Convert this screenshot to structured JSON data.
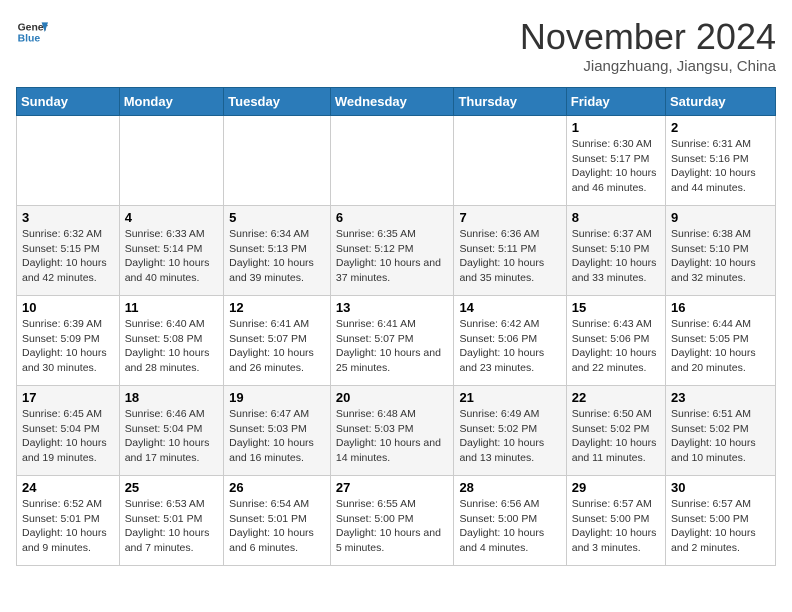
{
  "header": {
    "logo_line1": "General",
    "logo_line2": "Blue",
    "month": "November 2024",
    "location": "Jiangzhuang, Jiangsu, China"
  },
  "weekdays": [
    "Sunday",
    "Monday",
    "Tuesday",
    "Wednesday",
    "Thursday",
    "Friday",
    "Saturday"
  ],
  "weeks": [
    [
      {
        "day": "",
        "info": ""
      },
      {
        "day": "",
        "info": ""
      },
      {
        "day": "",
        "info": ""
      },
      {
        "day": "",
        "info": ""
      },
      {
        "day": "",
        "info": ""
      },
      {
        "day": "1",
        "info": "Sunrise: 6:30 AM\nSunset: 5:17 PM\nDaylight: 10 hours and 46 minutes."
      },
      {
        "day": "2",
        "info": "Sunrise: 6:31 AM\nSunset: 5:16 PM\nDaylight: 10 hours and 44 minutes."
      }
    ],
    [
      {
        "day": "3",
        "info": "Sunrise: 6:32 AM\nSunset: 5:15 PM\nDaylight: 10 hours and 42 minutes."
      },
      {
        "day": "4",
        "info": "Sunrise: 6:33 AM\nSunset: 5:14 PM\nDaylight: 10 hours and 40 minutes."
      },
      {
        "day": "5",
        "info": "Sunrise: 6:34 AM\nSunset: 5:13 PM\nDaylight: 10 hours and 39 minutes."
      },
      {
        "day": "6",
        "info": "Sunrise: 6:35 AM\nSunset: 5:12 PM\nDaylight: 10 hours and 37 minutes."
      },
      {
        "day": "7",
        "info": "Sunrise: 6:36 AM\nSunset: 5:11 PM\nDaylight: 10 hours and 35 minutes."
      },
      {
        "day": "8",
        "info": "Sunrise: 6:37 AM\nSunset: 5:10 PM\nDaylight: 10 hours and 33 minutes."
      },
      {
        "day": "9",
        "info": "Sunrise: 6:38 AM\nSunset: 5:10 PM\nDaylight: 10 hours and 32 minutes."
      }
    ],
    [
      {
        "day": "10",
        "info": "Sunrise: 6:39 AM\nSunset: 5:09 PM\nDaylight: 10 hours and 30 minutes."
      },
      {
        "day": "11",
        "info": "Sunrise: 6:40 AM\nSunset: 5:08 PM\nDaylight: 10 hours and 28 minutes."
      },
      {
        "day": "12",
        "info": "Sunrise: 6:41 AM\nSunset: 5:07 PM\nDaylight: 10 hours and 26 minutes."
      },
      {
        "day": "13",
        "info": "Sunrise: 6:41 AM\nSunset: 5:07 PM\nDaylight: 10 hours and 25 minutes."
      },
      {
        "day": "14",
        "info": "Sunrise: 6:42 AM\nSunset: 5:06 PM\nDaylight: 10 hours and 23 minutes."
      },
      {
        "day": "15",
        "info": "Sunrise: 6:43 AM\nSunset: 5:06 PM\nDaylight: 10 hours and 22 minutes."
      },
      {
        "day": "16",
        "info": "Sunrise: 6:44 AM\nSunset: 5:05 PM\nDaylight: 10 hours and 20 minutes."
      }
    ],
    [
      {
        "day": "17",
        "info": "Sunrise: 6:45 AM\nSunset: 5:04 PM\nDaylight: 10 hours and 19 minutes."
      },
      {
        "day": "18",
        "info": "Sunrise: 6:46 AM\nSunset: 5:04 PM\nDaylight: 10 hours and 17 minutes."
      },
      {
        "day": "19",
        "info": "Sunrise: 6:47 AM\nSunset: 5:03 PM\nDaylight: 10 hours and 16 minutes."
      },
      {
        "day": "20",
        "info": "Sunrise: 6:48 AM\nSunset: 5:03 PM\nDaylight: 10 hours and 14 minutes."
      },
      {
        "day": "21",
        "info": "Sunrise: 6:49 AM\nSunset: 5:02 PM\nDaylight: 10 hours and 13 minutes."
      },
      {
        "day": "22",
        "info": "Sunrise: 6:50 AM\nSunset: 5:02 PM\nDaylight: 10 hours and 11 minutes."
      },
      {
        "day": "23",
        "info": "Sunrise: 6:51 AM\nSunset: 5:02 PM\nDaylight: 10 hours and 10 minutes."
      }
    ],
    [
      {
        "day": "24",
        "info": "Sunrise: 6:52 AM\nSunset: 5:01 PM\nDaylight: 10 hours and 9 minutes."
      },
      {
        "day": "25",
        "info": "Sunrise: 6:53 AM\nSunset: 5:01 PM\nDaylight: 10 hours and 7 minutes."
      },
      {
        "day": "26",
        "info": "Sunrise: 6:54 AM\nSunset: 5:01 PM\nDaylight: 10 hours and 6 minutes."
      },
      {
        "day": "27",
        "info": "Sunrise: 6:55 AM\nSunset: 5:00 PM\nDaylight: 10 hours and 5 minutes."
      },
      {
        "day": "28",
        "info": "Sunrise: 6:56 AM\nSunset: 5:00 PM\nDaylight: 10 hours and 4 minutes."
      },
      {
        "day": "29",
        "info": "Sunrise: 6:57 AM\nSunset: 5:00 PM\nDaylight: 10 hours and 3 minutes."
      },
      {
        "day": "30",
        "info": "Sunrise: 6:57 AM\nSunset: 5:00 PM\nDaylight: 10 hours and 2 minutes."
      }
    ]
  ]
}
